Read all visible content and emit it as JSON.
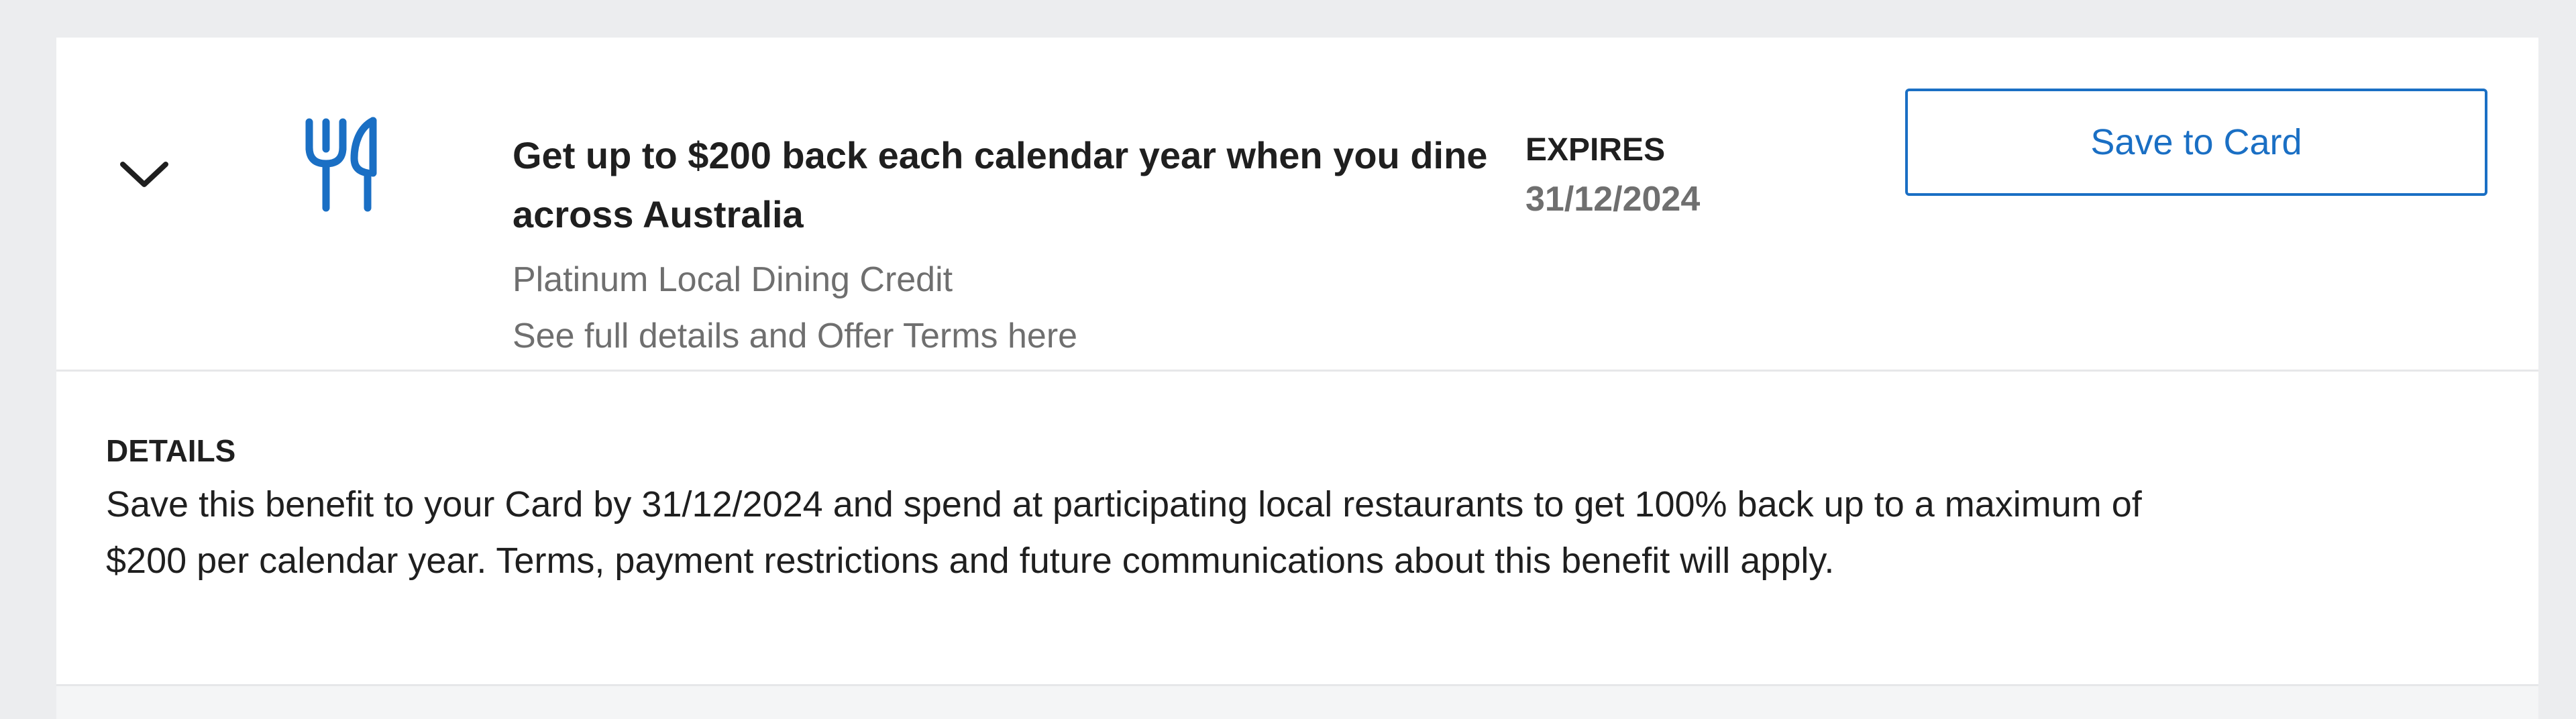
{
  "offer": {
    "title": "Get up to $200 back each calendar year when you dine across Australia",
    "subtitle": "Platinum Local Dining Credit",
    "terms_link": "See full details and Offer Terms here",
    "expires_label": "EXPIRES",
    "expires_date": "31/12/2024",
    "save_label": "Save to Card",
    "icon": "dining-icon",
    "toggle_icon": "chevron-down-icon"
  },
  "details": {
    "heading": "DETAILS",
    "text": "Save this benefit to your Card by 31/12/2024 and spend at participating local restaurants to get 100% back up to a maximum of $200 per calendar year. Terms, payment restrictions and future communications about this benefit will apply."
  },
  "colors": {
    "accent": "#1a6fc4",
    "text": "#1f1f1f",
    "muted": "#6f6f6f",
    "page_bg": "#ecedef",
    "divider": "#e6e7e9"
  }
}
